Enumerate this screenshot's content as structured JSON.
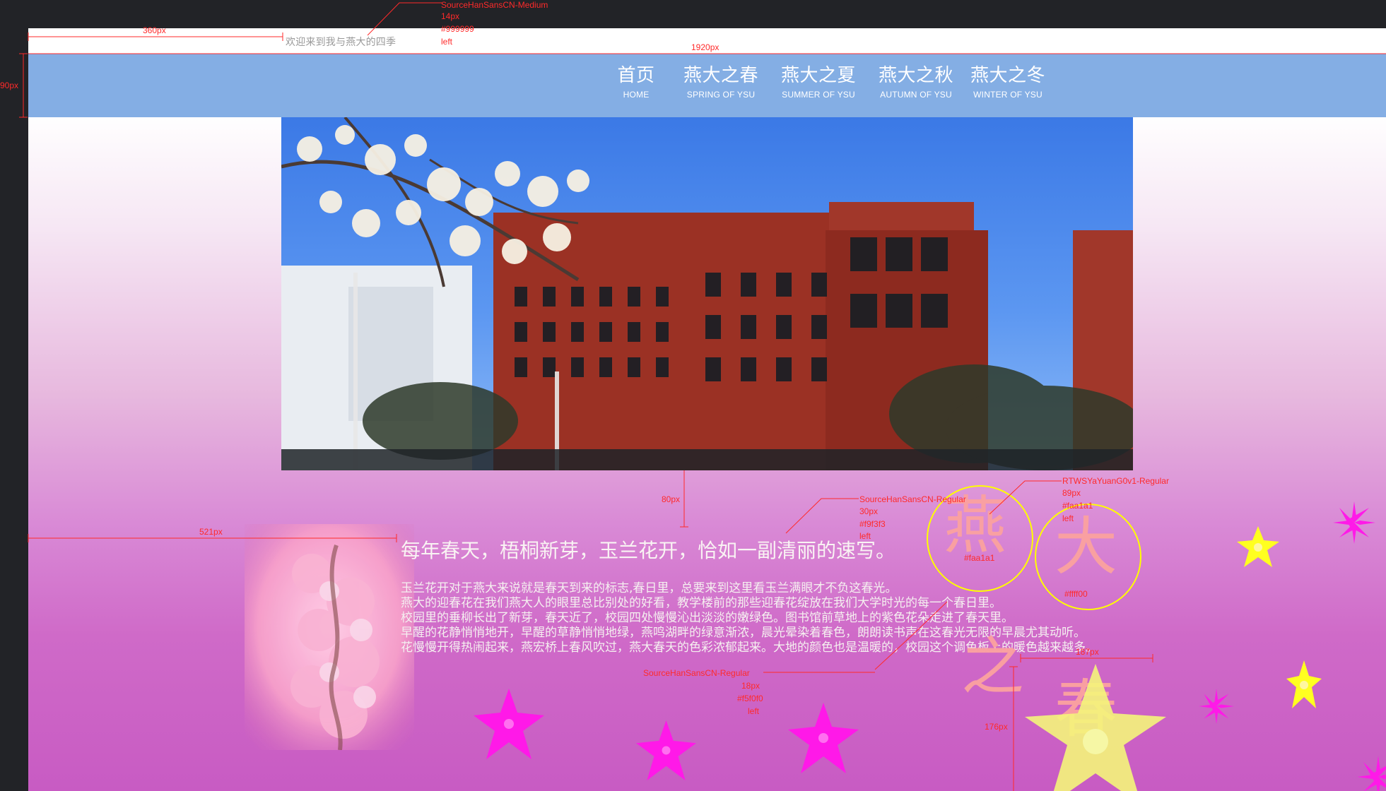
{
  "page": {
    "welcome_text": "欢迎来到我与燕大的四季"
  },
  "nav": {
    "items": [
      {
        "zh": "首页",
        "en": "HOME"
      },
      {
        "zh": "燕大之春",
        "en": "SPRING OF YSU"
      },
      {
        "zh": "燕大之夏",
        "en": "SUMMER OF YSU"
      },
      {
        "zh": "燕大之秋",
        "en": "AUTUMN OF YSU"
      },
      {
        "zh": "燕大之冬",
        "en": "WINTER OF YSU"
      }
    ],
    "background_color": "#84aee4"
  },
  "content": {
    "headline": "每年春天，梧桐新芽，玉兰花开，恰如一副清丽的速写。",
    "paragraph_lines": [
      "玉兰花开对于燕大来说就是春天到来的标志,春日里，总要来到这里看玉兰满眼才不负这春光。",
      "燕大的迎春花在我们燕大人的眼里总比别处的好看，教学楼前的那些迎春花绽放在我们大学时光的每一个春日里。",
      "校园里的垂柳长出了新芽，春天近了，校园四处慢慢沁出淡淡的嫩绿色。图书馆前草地上的紫色花朵走进了春天里。",
      "早醒的花静悄悄地开，早醒的草静悄悄地绿，燕鸣湖畔的绿意渐浓，晨光晕染着春色，朗朗读书声在这春光无限的早晨尤其动听。",
      "花慢慢开得热闹起来，燕宏桥上春风吹过，燕大春天的色彩浓郁起来。大地的颜色也是温暖的，校园这个调色板上的暖色越来越多。"
    ],
    "title_chars": [
      "燕",
      "大",
      "之",
      "春"
    ]
  },
  "annotations": {
    "top_font": [
      "SourceHanSansCN-Medium",
      "14px",
      "#999999",
      "left"
    ],
    "width_360": "360px",
    "width_1920": "1920px",
    "height_90": "90px",
    "height_80": "80px",
    "width_521": "521px",
    "headline_font": [
      "SourceHanSansCN-Regular",
      "30px",
      "#f9f3f3",
      "left"
    ],
    "title_font": [
      "RTWSYaYuanG0v1-Regular",
      "89px",
      "#faa1a1",
      "left"
    ],
    "color_faa1a1": "#faa1a1",
    "color_ffff00": "#ffff00",
    "paragraph_font": [
      "SourceHanSansCN-Regular",
      "18px",
      "#f5f0f0",
      "left"
    ],
    "width_187": "187px",
    "height_176": "176px"
  }
}
